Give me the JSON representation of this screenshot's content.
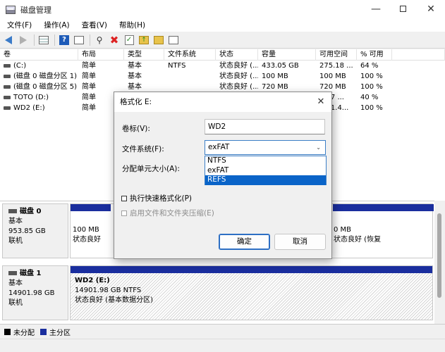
{
  "window": {
    "title": "磁盘管理"
  },
  "menu": [
    "文件(F)",
    "操作(A)",
    "查看(V)",
    "帮助(H)"
  ],
  "table": {
    "headers": [
      "卷",
      "布局",
      "类型",
      "文件系统",
      "状态",
      "容量",
      "可用空间",
      "% 可用",
      ""
    ],
    "rows": [
      [
        "(C:)",
        "简单",
        "基本",
        "NTFS",
        "状态良好 (...",
        "433.05 GB",
        "275.18 ...",
        "64 %"
      ],
      [
        "(磁盘 0 磁盘分区 1)",
        "简单",
        "基本",
        "",
        "状态良好 (...",
        "100 MB",
        "100 MB",
        "100 %"
      ],
      [
        "(磁盘 0 磁盘分区 5)",
        "简单",
        "基本",
        "",
        "状态良好 (...",
        "720 MB",
        "720 MB",
        "100 %"
      ],
      [
        "TOTO (D:)",
        "简单",
        "基本",
        "",
        "",
        "",
        "...17 ...",
        "40 %"
      ],
      [
        "WD2 (E:)",
        "简单",
        "",
        "",
        "",
        "",
        "...01.4...",
        "100 %"
      ]
    ]
  },
  "disks": {
    "disk0": {
      "name": "磁盘 0",
      "type": "基本",
      "size": "953.85 GB",
      "status": "联机",
      "part_left_size": "100 MB",
      "part_left_status": "状态良好",
      "part_right_size": "0 MB",
      "part_right_status": "状态良好 (恢复"
    },
    "disk1": {
      "name": "磁盘 1",
      "type": "基本",
      "size": "14901.98 GB",
      "status": "联机",
      "part_name": "WD2  (E:)",
      "part_size": "14901.98 GB NTFS",
      "part_status": "状态良好 (基本数据分区)"
    }
  },
  "legend": {
    "unallocated": "未分配",
    "primary": "主分区"
  },
  "dialog": {
    "title": "格式化 E:",
    "volume_label_label": "卷标(V):",
    "volume_label_value": "WD2",
    "filesystem_label": "文件系统(F):",
    "filesystem_value": "exFAT",
    "filesystem_options": [
      "NTFS",
      "exFAT",
      "REFS"
    ],
    "alloc_label": "分配单元大小(A):",
    "quick_format": "执行快速格式化(P)",
    "compression": "启用文件和文件夹压缩(E)",
    "ok": "确定",
    "cancel": "取消"
  },
  "colors": {
    "primary_partition": "#1a2e9e",
    "selection": "#0a64c8"
  }
}
